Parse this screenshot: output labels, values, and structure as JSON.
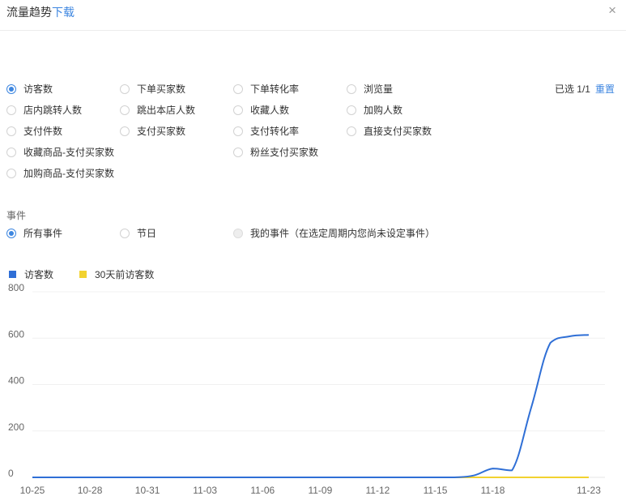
{
  "header": {
    "title": "流量趋势",
    "download": "下载",
    "close_glyph": "×"
  },
  "metrics": [
    {
      "label": "访客数",
      "checked": true
    },
    {
      "label": "下单买家数",
      "checked": false
    },
    {
      "label": "下单转化率",
      "checked": false
    },
    {
      "label": "浏览量",
      "checked": false
    },
    {
      "label": "店内跳转人数",
      "checked": false
    },
    {
      "label": "跳出本店人数",
      "checked": false
    },
    {
      "label": "收藏人数",
      "checked": false
    },
    {
      "label": "加购人数",
      "checked": false
    },
    {
      "label": "支付件数",
      "checked": false
    },
    {
      "label": "支付买家数",
      "checked": false
    },
    {
      "label": "支付转化率",
      "checked": false
    },
    {
      "label": "直接支付买家数",
      "checked": false
    },
    {
      "label": "收藏商品-支付买家数",
      "checked": false
    },
    {
      "label": "粉丝支付买家数",
      "checked": false
    },
    {
      "label": "加购商品-支付买家数",
      "checked": false
    }
  ],
  "selection": {
    "text": "已选 1/1",
    "reset": "重置"
  },
  "events": {
    "label": "事件",
    "options": [
      {
        "label": "所有事件",
        "checked": true
      },
      {
        "label": "节日",
        "checked": false
      },
      {
        "label": "我的事件（在选定周期内您尚未设定事件）",
        "checked": false,
        "disabled": true
      }
    ]
  },
  "colors": {
    "accent": "#3d86e0",
    "series1": "#2f6fd6",
    "series2": "#f2d230"
  },
  "chart_data": {
    "type": "line",
    "ylim": [
      0,
      800
    ],
    "yticks": [
      "0",
      "200",
      "400",
      "600",
      "800"
    ],
    "xticks": [
      "10-25",
      "10-28",
      "10-31",
      "11-03",
      "11-06",
      "11-09",
      "11-12",
      "11-15",
      "11-18",
      "11-23"
    ],
    "x": [
      "10-25",
      "10-26",
      "10-27",
      "10-28",
      "10-29",
      "10-30",
      "10-31",
      "11-01",
      "11-02",
      "11-03",
      "11-04",
      "11-05",
      "11-06",
      "11-07",
      "11-08",
      "11-09",
      "11-10",
      "11-11",
      "11-12",
      "11-13",
      "11-14",
      "11-15",
      "11-16",
      "11-17",
      "11-18",
      "11-19",
      "11-20",
      "11-21",
      "11-22",
      "11-23"
    ],
    "series": [
      {
        "name": "访客数",
        "color": "#2f6fd6",
        "values": [
          0,
          0,
          0,
          0,
          0,
          0,
          0,
          0,
          0,
          0,
          0,
          0,
          0,
          0,
          0,
          0,
          0,
          0,
          0,
          0,
          0,
          0,
          0,
          8,
          38,
          30,
          300,
          580,
          608,
          614
        ]
      },
      {
        "name": "30天前访客数",
        "color": "#f2d230",
        "values": [
          0,
          0,
          0,
          0,
          0,
          0,
          0,
          0,
          0,
          0,
          0,
          0,
          0,
          0,
          0,
          0,
          0,
          0,
          0,
          0,
          0,
          0,
          0,
          0,
          0,
          0,
          0,
          0,
          0,
          0
        ]
      }
    ]
  }
}
